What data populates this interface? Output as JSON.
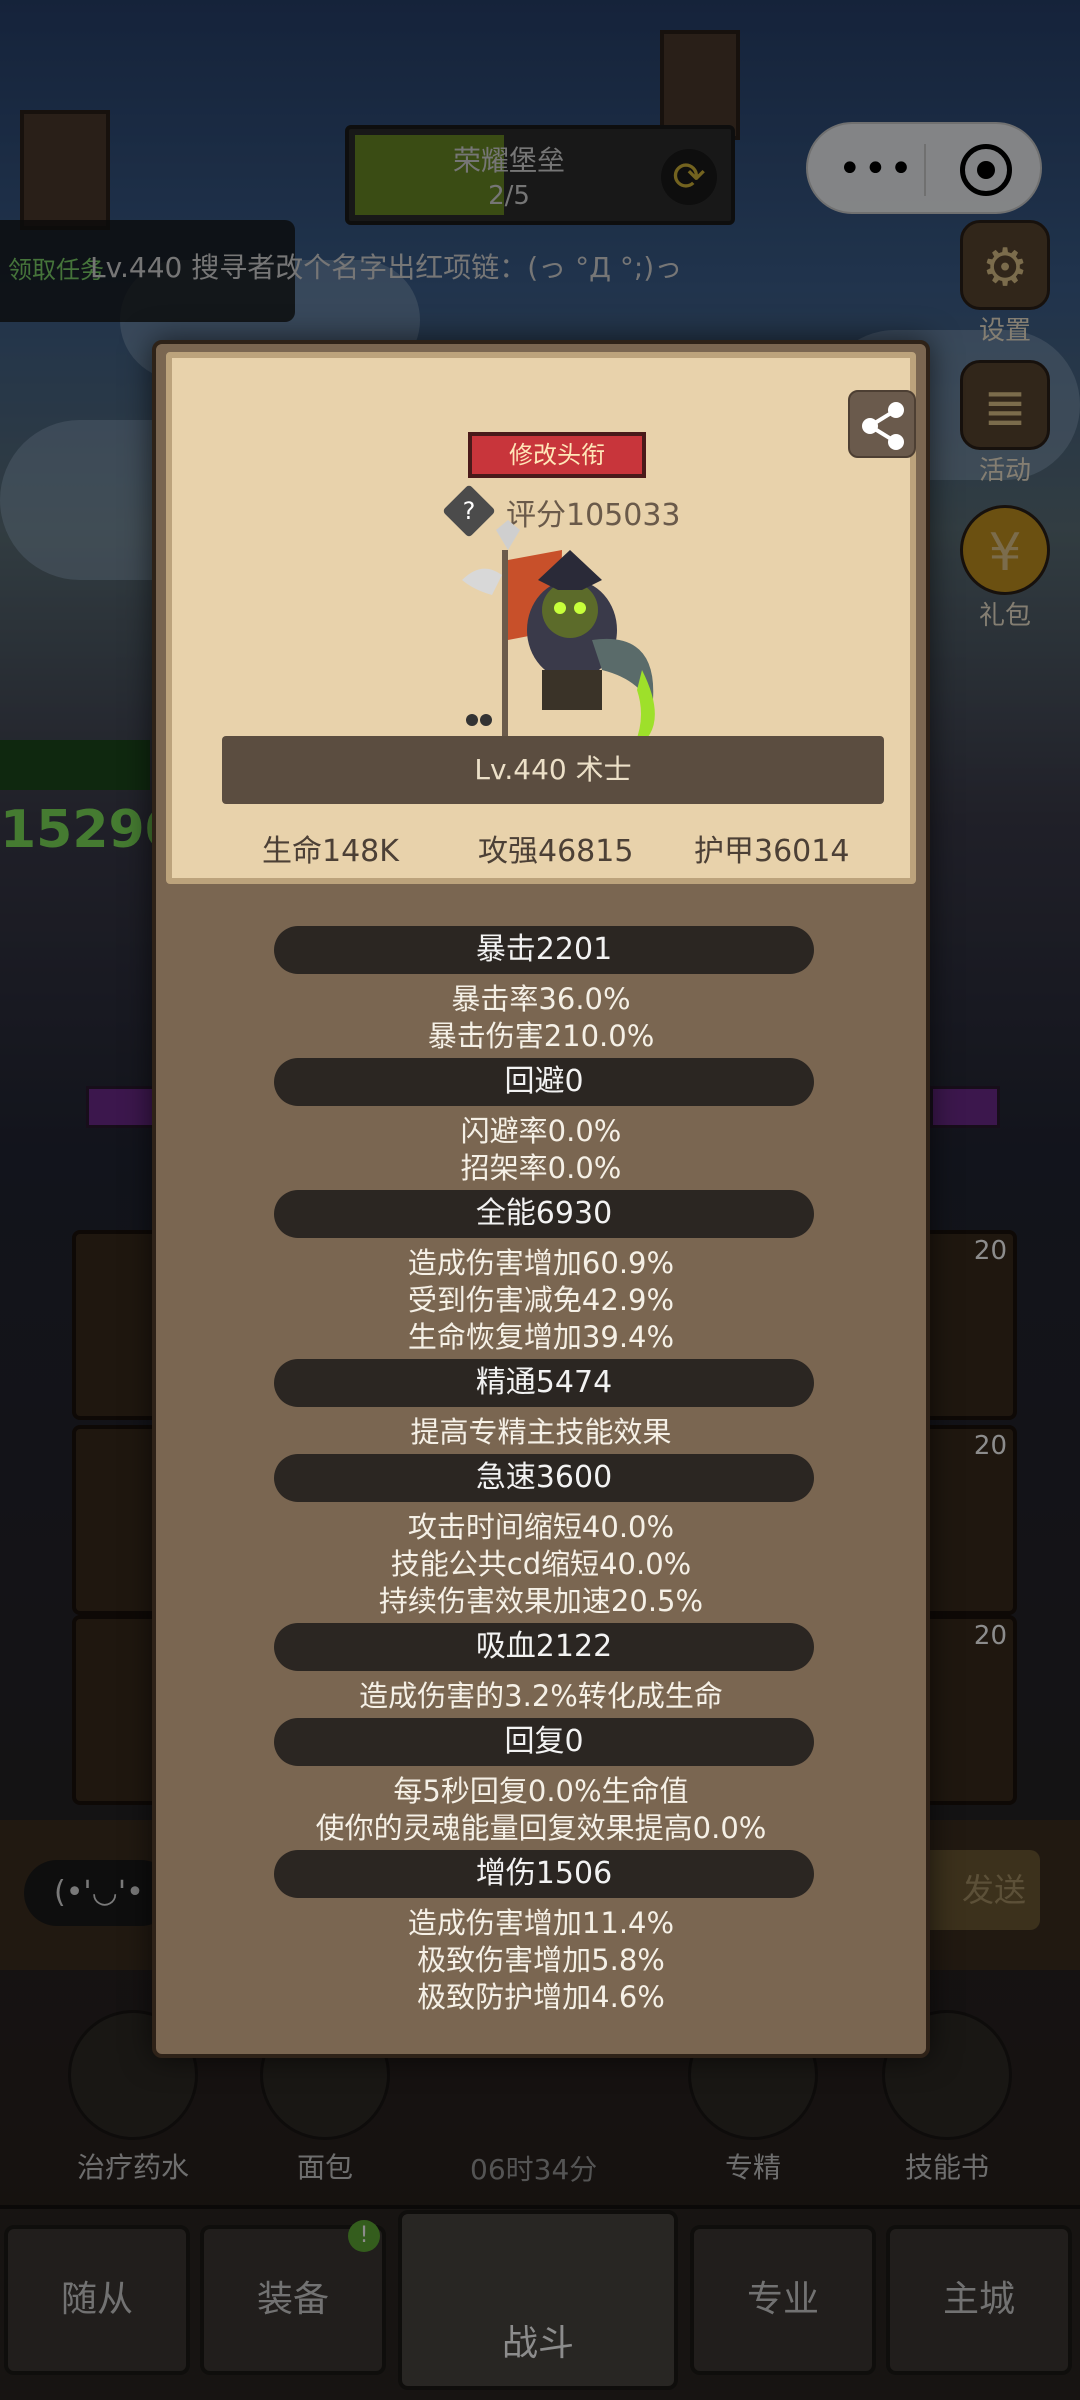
{
  "background": {
    "progress": {
      "title": "荣耀堡垒",
      "count": "2/5",
      "fill_fraction": 0.4
    },
    "ticker": "Lv.440 搜寻者改个名字出红项链：(っ °Д °;)っ",
    "task_label": "领取任务",
    "side_icons": [
      {
        "label": "设置",
        "icon": "gear-icon"
      },
      {
        "label": "活动",
        "icon": "scroll-icon"
      },
      {
        "label": "礼包",
        "icon": "coin-icon"
      }
    ],
    "slot_badges": [
      "20",
      "20",
      "20"
    ],
    "tools": [
      {
        "label": "治疗药水",
        "icon": "potion-icon"
      },
      {
        "label": "面包",
        "icon": "bread-icon"
      },
      {
        "label": "专精",
        "icon": "target-icon"
      },
      {
        "label": "技能书",
        "icon": "book-icon"
      }
    ],
    "timer": "06时34分",
    "send_label": "发送",
    "nav": [
      {
        "label": "随从"
      },
      {
        "label": "装备",
        "badge": "!"
      },
      {
        "label": "战斗"
      },
      {
        "label": "专业"
      },
      {
        "label": "主城"
      }
    ]
  },
  "panel": {
    "title_button": "修改头衔",
    "help_icon": "?",
    "score": "评分105033",
    "level_class": "Lv.440 术士",
    "base_stats": {
      "hp": "生命148K",
      "attack": "攻强46815",
      "armor": "护甲36014"
    },
    "sections": [
      {
        "header": "暴击2201",
        "lines": [
          "暴击率36.0%",
          "暴击伤害210.0%"
        ]
      },
      {
        "header": "回避0",
        "lines": [
          "闪避率0.0%",
          "招架率0.0%"
        ]
      },
      {
        "header": "全能6930",
        "lines": [
          "造成伤害增加60.9%",
          "受到伤害减免42.9%",
          "生命恢复增加39.4%"
        ]
      },
      {
        "header": "精通5474",
        "lines": [
          "提高专精主技能效果"
        ]
      },
      {
        "header": "急速3600",
        "lines": [
          "攻击时间缩短40.0%",
          "技能公共cd缩短40.0%",
          "持续伤害效果加速20.5%"
        ]
      },
      {
        "header": "吸血2122",
        "lines": [
          "造成伤害的3.2%转化成生命"
        ]
      },
      {
        "header": "回复0",
        "lines": [
          "每5秒回复0.0%生命值",
          "使你的灵魂能量回复效果提高0.0%"
        ]
      },
      {
        "header": "增伤1506",
        "lines": [
          "造成伤害增加11.4%",
          "极致伤害增加5.8%",
          "极致防护增加4.6%"
        ]
      }
    ]
  }
}
